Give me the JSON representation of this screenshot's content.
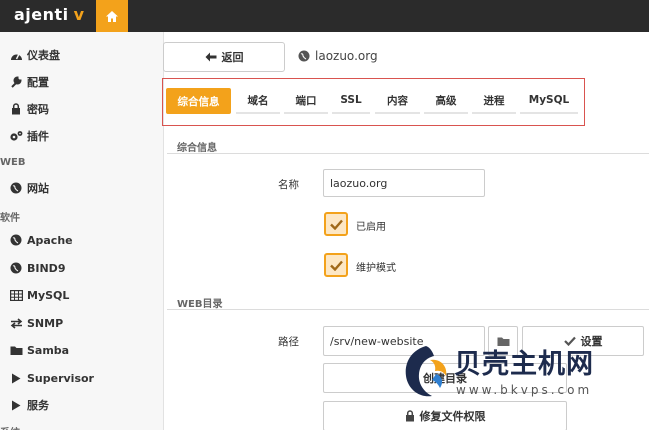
{
  "app": {
    "brand": "ajenti",
    "brand_suffix": "v",
    "accent_color": "#f3a21b",
    "home_icon": "home-icon"
  },
  "sidebar": {
    "items_top": [
      {
        "label": "仪表盘",
        "icon": "dashboard-icon"
      },
      {
        "label": "配置",
        "icon": "wrench-icon"
      },
      {
        "label": "密码",
        "icon": "lock-icon"
      },
      {
        "label": "插件",
        "icon": "cogs-icon"
      }
    ],
    "section_web": "WEB",
    "items_web": [
      {
        "label": "网站",
        "icon": "globe-icon"
      }
    ],
    "section_software": "软件",
    "items_software": [
      {
        "label": "Apache",
        "icon": "globe-icon"
      },
      {
        "label": "BIND9",
        "icon": "globe-icon"
      },
      {
        "label": "MySQL",
        "icon": "table-icon"
      },
      {
        "label": "SNMP",
        "icon": "exchange-icon"
      },
      {
        "label": "Samba",
        "icon": "folder-icon"
      },
      {
        "label": "Supervisor",
        "icon": "play-icon"
      },
      {
        "label": "服务",
        "icon": "play-icon"
      }
    ],
    "section_system": "系统"
  },
  "toolbar": {
    "back_label": "返回",
    "site_name": "laozuo.org"
  },
  "tabs": [
    {
      "label": "综合信息",
      "active": true
    },
    {
      "label": "域名",
      "active": false
    },
    {
      "label": "端口",
      "active": false
    },
    {
      "label": "SSL",
      "active": false
    },
    {
      "label": "内容",
      "active": false
    },
    {
      "label": "高级",
      "active": false
    },
    {
      "label": "进程",
      "active": false
    },
    {
      "label": "MySQL",
      "active": false
    }
  ],
  "general": {
    "heading": "综合信息",
    "name_label": "名称",
    "name_value": "laozuo.org",
    "enabled_label": "已启用",
    "enabled_checked": true,
    "maintenance_label": "维护模式",
    "maintenance_checked": true
  },
  "webdir": {
    "heading": "WEB目录",
    "path_label": "路径",
    "path_value": "/srv/new-website",
    "set_label": "设置",
    "create_dir_label": "创建目录",
    "fix_perms_label": "修复文件权限"
  },
  "watermark": {
    "text": "贝壳主机网",
    "url": "www.bkvps.com"
  }
}
